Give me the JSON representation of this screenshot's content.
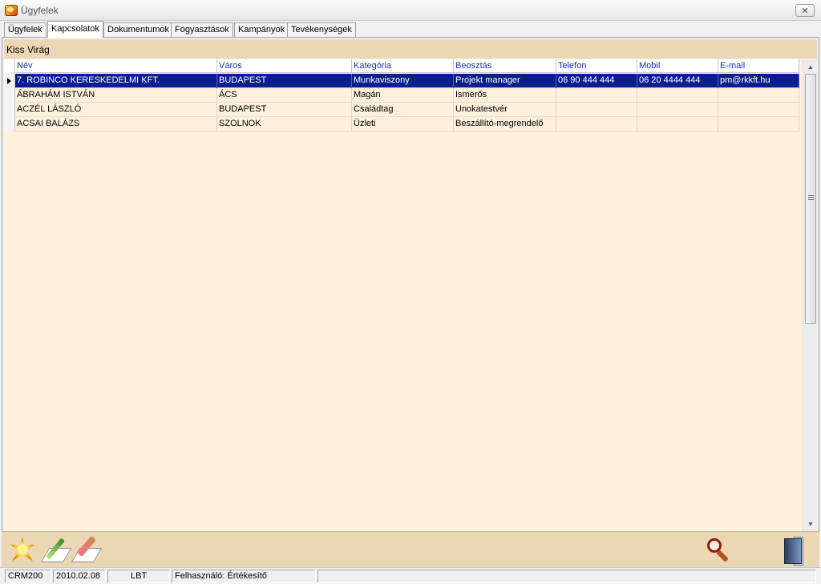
{
  "window": {
    "title": "Ügyfelek"
  },
  "tabs": [
    {
      "label": "Ügyfelek",
      "active": false
    },
    {
      "label": "Kapcsolatok",
      "active": true
    },
    {
      "label": "Dokumentumok",
      "active": false
    },
    {
      "label": "Fogyasztások",
      "active": false
    },
    {
      "label": "Kampányok",
      "active": false
    },
    {
      "label": "Tevékenységek",
      "active": false
    }
  ],
  "header": {
    "name": "Kiss Virág"
  },
  "table": {
    "columns": [
      "Név",
      "Város",
      "Kategória",
      "Beosztás",
      "Telefon",
      "Mobil",
      "E-mail"
    ],
    "rows": [
      [
        "7. ROBINCO KERESKEDELMI KFT.",
        "BUDAPEST",
        "Munkaviszony",
        "Projekt manager",
        "06 90 444 444",
        "06 20 4444 444",
        "pm@rkkft.hu"
      ],
      [
        "ÁBRAHÁM ISTVÁN",
        "ÁCS",
        "Magán",
        "Ismerős",
        "",
        "",
        ""
      ],
      [
        "ACZÉL LÁSZLÓ",
        "BUDAPEST",
        "Családtag",
        "Unokatestvér",
        "",
        "",
        ""
      ],
      [
        "ACSAI BALÁZS",
        "SZOLNOK",
        "Üzleti",
        "Beszállító-megrendelő",
        "",
        "",
        ""
      ]
    ],
    "selected_row": 0
  },
  "toolbar": {
    "icons": [
      "new-star-icon",
      "edit-pencil-icon",
      "delete-eraser-icon",
      "search-magnifier-icon",
      "exit-door-icon"
    ]
  },
  "status": {
    "app": "CRM200",
    "date": "2010.02.08",
    "code": "LBT",
    "user": "Felhasználó: Értékesítő"
  },
  "colors": {
    "selection": "#0a1f8c",
    "grid_bg": "#fdf0dc",
    "band": "#ebd7b3",
    "header_text": "#1a35a6"
  }
}
